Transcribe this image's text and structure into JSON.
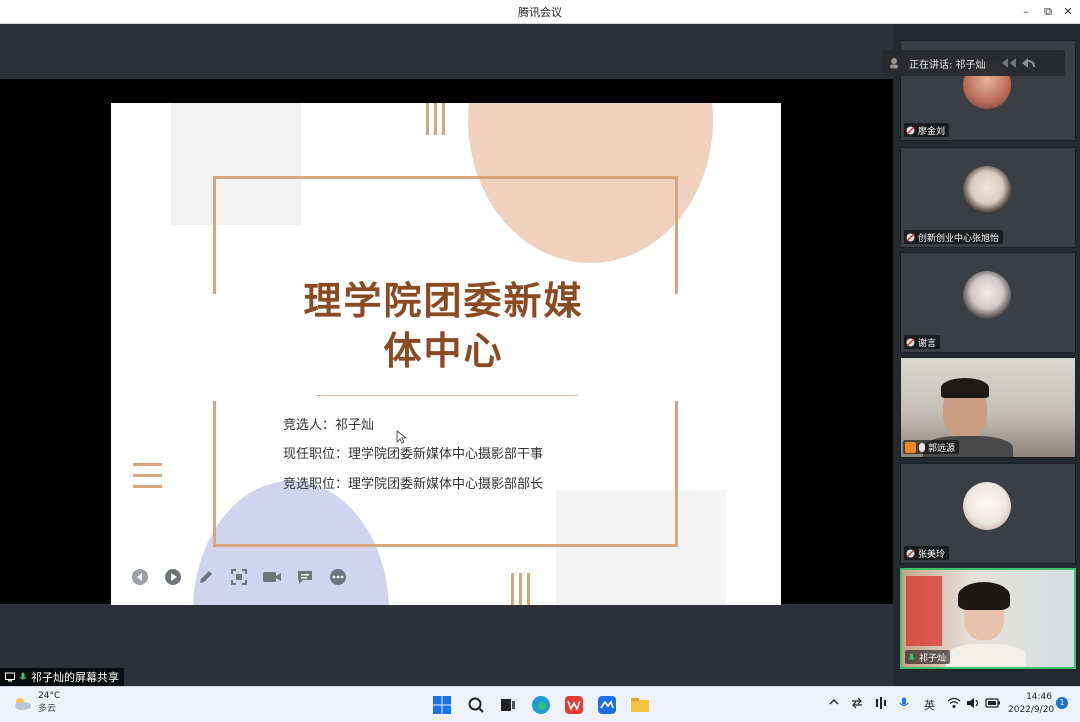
{
  "window": {
    "title": "腾讯会议",
    "minimize": "–",
    "restore": "⧉",
    "close": "✕"
  },
  "slide": {
    "title_line1": "理学院团委新媒",
    "title_line2": "体中心",
    "candidate": "竞选人：祁子灿",
    "current_position": "现任职位：理学院团委新媒体中心摄影部干事",
    "target_position": "竞选职位：理学院团委新媒体中心摄影部部长",
    "tools": [
      "prev-icon",
      "play-icon",
      "pen-icon",
      "screenshot-icon",
      "camera-icon",
      "comment-icon",
      "more-icon"
    ]
  },
  "speaking": {
    "label": "正在讲话: 祁子灿"
  },
  "participants": [
    {
      "name": "廖金刘",
      "type": "avatar",
      "accent": "#c9876a"
    },
    {
      "name": "创新创业中心张旭怡",
      "type": "avatar",
      "accent": "#dcd3c8"
    },
    {
      "name": "谢言",
      "type": "avatar",
      "accent": "#b9b4b4"
    },
    {
      "name": "郭远源",
      "type": "video",
      "accent": "#7c6e63"
    },
    {
      "name": "张美玲",
      "type": "avatar",
      "accent": "#e7e0dc"
    },
    {
      "name": "祁子灿",
      "type": "video",
      "accent": "#c6d0d2"
    }
  ],
  "share_label": "祁子灿的屏幕共享",
  "taskbar": {
    "weather_temp": "24°C",
    "weather_desc": "多云",
    "lang": "英",
    "time": "14:46",
    "date": "2022/9/20",
    "notifications": "1"
  }
}
